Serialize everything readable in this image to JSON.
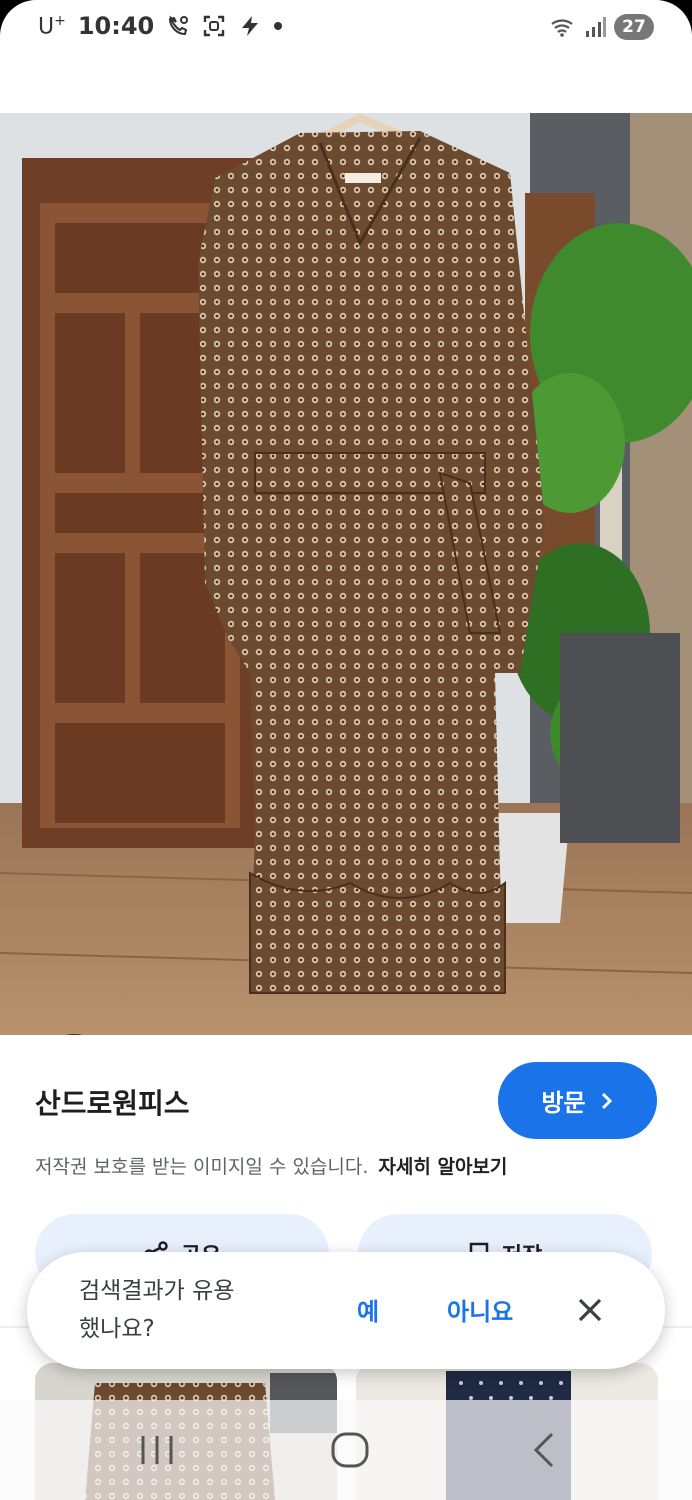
{
  "status_bar": {
    "carrier": "U",
    "carrier_sup": "+",
    "time": "10:40",
    "battery": "27",
    "icons": [
      "call-forward-icon",
      "screenshot-icon",
      "charging-bolt-icon",
      "dot-icon",
      "wifi-icon",
      "signal-icon"
    ]
  },
  "result": {
    "title": "산드로원피스",
    "visit_label": "방문",
    "copyright_notice": "저작권 보호를 받는 이미지일 수 있습니다.",
    "learn_more": "자세히 알아보기",
    "share_label": "공유",
    "save_label": "저장"
  },
  "feedback": {
    "question": "검색결과가 유용했나요?",
    "yes": "예",
    "no": "아니요"
  },
  "colors": {
    "accent": "#1a73e8",
    "chip_bg": "#e8f0fe",
    "dress": "#6b4a2f"
  }
}
